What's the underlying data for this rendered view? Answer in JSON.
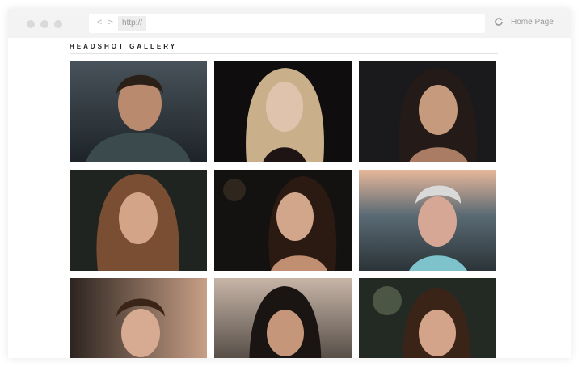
{
  "browser": {
    "nav_arrows": "< >",
    "url_text": "http://",
    "home_link": "Home Page",
    "icons": [
      "back-forward-icon",
      "reload-icon"
    ]
  },
  "page": {
    "title": "HEADSHOT GALLERY"
  },
  "gallery": [
    {
      "alt": "portrait-1"
    },
    {
      "alt": "portrait-2"
    },
    {
      "alt": "portrait-3"
    },
    {
      "alt": "portrait-4"
    },
    {
      "alt": "portrait-5"
    },
    {
      "alt": "portrait-6"
    },
    {
      "alt": "portrait-7"
    },
    {
      "alt": "portrait-8"
    },
    {
      "alt": "portrait-9"
    }
  ],
  "colors": {
    "chrome": "#f3f3f3",
    "dots": "#dadada",
    "muted_text": "#9a9a9a"
  }
}
